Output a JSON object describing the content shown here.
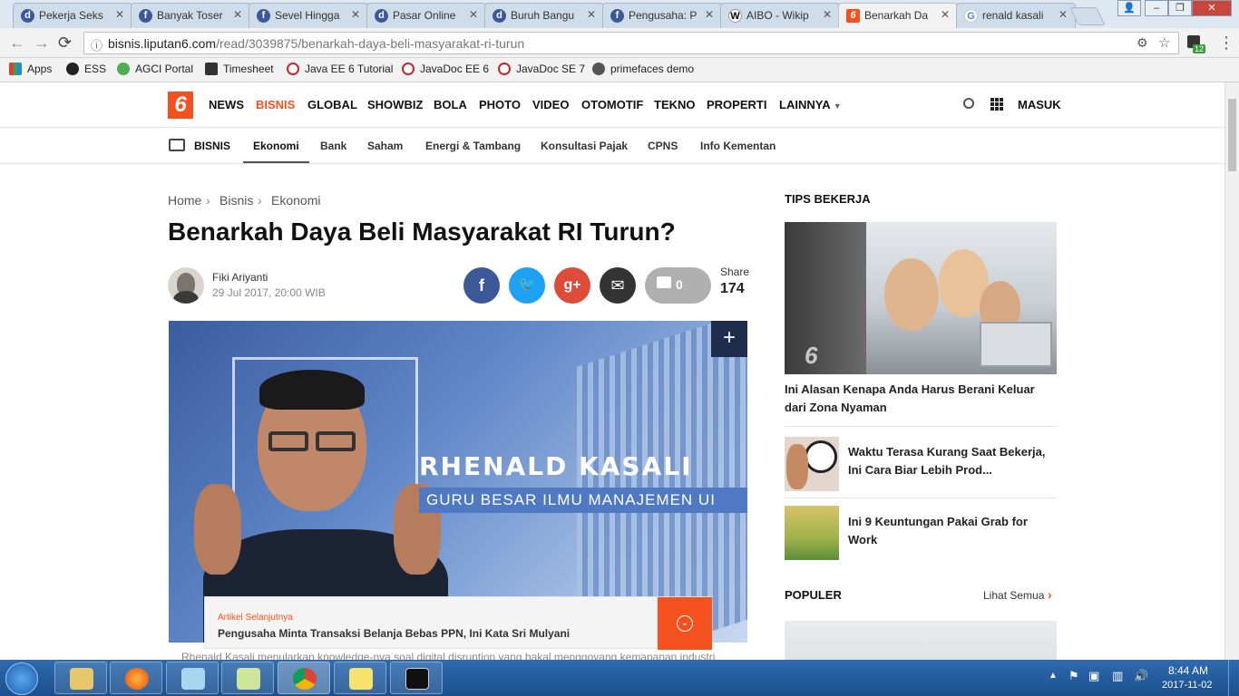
{
  "browser": {
    "tabs": [
      {
        "title": "Pekerja Seks",
        "favicon": "detik-d-icon",
        "active": false
      },
      {
        "title": "Banyak Toser",
        "favicon": "facebook-icon",
        "active": false
      },
      {
        "title": "Sevel Hingga",
        "favicon": "facebook-icon",
        "active": false
      },
      {
        "title": "Pasar Online",
        "favicon": "detik-d-icon",
        "active": false
      },
      {
        "title": "Buruh Bangu",
        "favicon": "detik-d-icon",
        "active": false
      },
      {
        "title": "Pengusaha: P",
        "favicon": "facebook-icon",
        "active": false
      },
      {
        "title": "AIBO - Wikip",
        "favicon": "wikipedia-icon",
        "active": false
      },
      {
        "title": "Benarkah Da",
        "favicon": "liputan6-icon",
        "active": true
      },
      {
        "title": "renald kasali",
        "favicon": "google-icon",
        "active": false
      }
    ],
    "url_host": "bisnis.liputan6.com",
    "url_path": "/read/3039875/benarkah-daya-beli-masyarakat-ri-turun",
    "extension_badge": "12",
    "bookmarks": [
      "Apps",
      "ESS",
      "AGCI Portal",
      "Timesheet",
      "Java EE 6 Tutorial",
      "JavaDoc EE 6",
      "JavaDoc SE 7",
      "primefaces demo"
    ]
  },
  "site": {
    "logo_text": "6",
    "nav": [
      "NEWS",
      "BISNIS",
      "GLOBAL",
      "SHOWBIZ",
      "BOLA",
      "PHOTO",
      "VIDEO",
      "OTOMOTIF",
      "TEKNO",
      "PROPERTI",
      "LAINNYA"
    ],
    "login": "MASUK",
    "section": "BISNIS",
    "subnav": [
      "Ekonomi",
      "Bank",
      "Saham",
      "Energi & Tambang",
      "Konsultasi Pajak",
      "CPNS",
      "Info Kementan"
    ]
  },
  "article": {
    "breadcrumb": [
      "Home",
      "Bisnis",
      "Ekonomi"
    ],
    "title": "Benarkah Daya Beli Masyarakat RI Turun?",
    "author": "Fiki Ariyanti",
    "date": "29 Jul 2017, 20:00 WIB",
    "comments": "0",
    "share_label": "Share",
    "share_count": "174",
    "hero_name": "RHENALD KASALI",
    "hero_caption": "GURU BESAR ILMU MANAJEMEN UI",
    "expand_glyph": "+",
    "next_label": "Artikel Selanjutnya",
    "next_title": "Pengusaha Minta Transaksi Belanja Bebas PPN, Ini Kata Sri Mulyani",
    "body_preview": "Rhenald Kasali menularkan knowledge-nya soal digital disruption yang bakal menggoyang kemapanan industri"
  },
  "sidebar": {
    "tips_title": "TIPS BEKERJA",
    "tips_main": "Ini Alasan Kenapa Anda Harus Berani Keluar dari Zona Nyaman",
    "tips_items": [
      "Waktu Terasa Kurang Saat Bekerja, Ini Cara Biar Lebih Prod...",
      "Ini 9 Keuntungan Pakai Grab for Work"
    ],
    "populer_title": "POPULER",
    "see_all": "Lihat Semua"
  },
  "taskbar": {
    "time": "8:44 AM",
    "date": "2017-11-02"
  },
  "colors": {
    "brand": "#f4511e",
    "facebook": "#3b5998",
    "twitter": "#1da1f2",
    "googleplus": "#dd4b39",
    "mail": "#333333",
    "comment": "#b0b0b0"
  }
}
